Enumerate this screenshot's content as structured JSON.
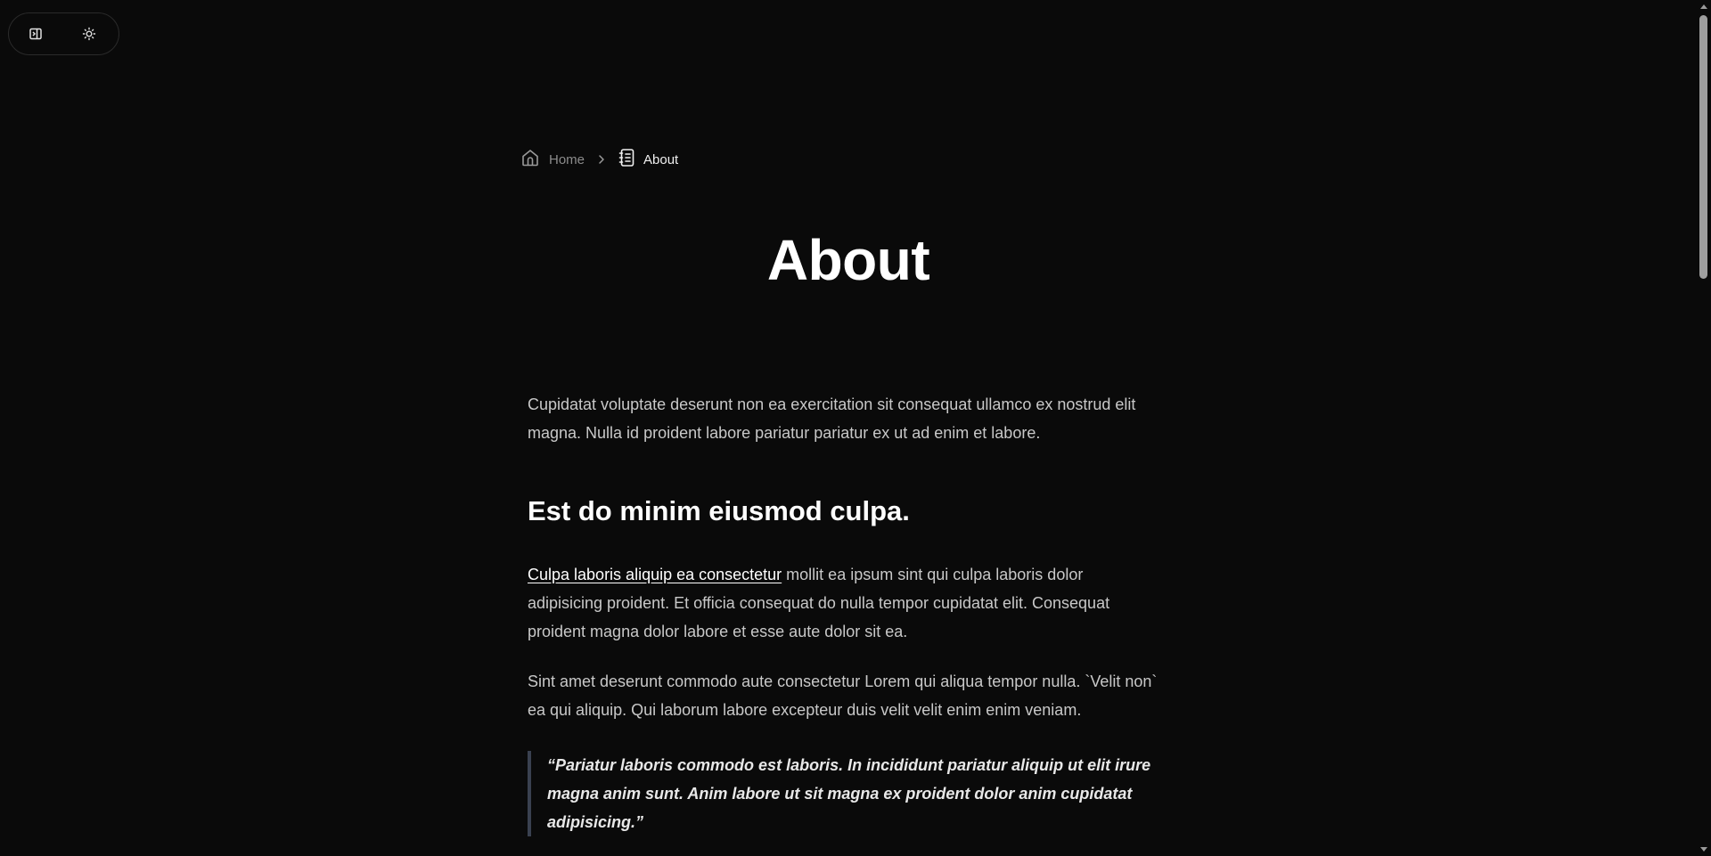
{
  "controls": {
    "sidebar_toggle_icon": "sidebar-panel-icon",
    "theme_toggle_icon": "sun-icon"
  },
  "breadcrumb": {
    "home_label": "Home",
    "home_icon": "home-icon",
    "separator_icon": "chevron-right-icon",
    "current_label": "About",
    "current_icon": "notebook-icon"
  },
  "page": {
    "title": "About"
  },
  "article": {
    "intro": "Cupidatat voluptate deserunt non ea exercitation sit consequat ullamco ex nostrud elit magna. Nulla id proident labore pariatur pariatur ex ut ad enim et labore.",
    "heading": "Est do minim eiusmod culpa.",
    "para2_link": "Culpa laboris aliquip ea consectetur",
    "para2_rest": " mollit ea ipsum sint qui culpa laboris dolor adipisicing proident. Et officia consequat do nulla tempor cupidatat elit. Consequat proident magna dolor labore et esse aute dolor sit ea.",
    "para3": "Sint amet deserunt commodo aute consectetur Lorem qui aliqua tempor nulla. `Velit non` ea qui aliquip. Qui laborum labore excepteur duis velit velit enim enim veniam.",
    "quote": "“Pariatur laboris commodo est laboris. In incididunt pariatur aliquip ut elit irure magna anim sunt. Anim labore ut sit magna ex proident dolor anim cupidatat adipisicing.”"
  },
  "colors": {
    "background": "#0a0a0a",
    "text": "#c8c8c8",
    "heading": "#ffffff",
    "quote_border": "#3a4150"
  }
}
